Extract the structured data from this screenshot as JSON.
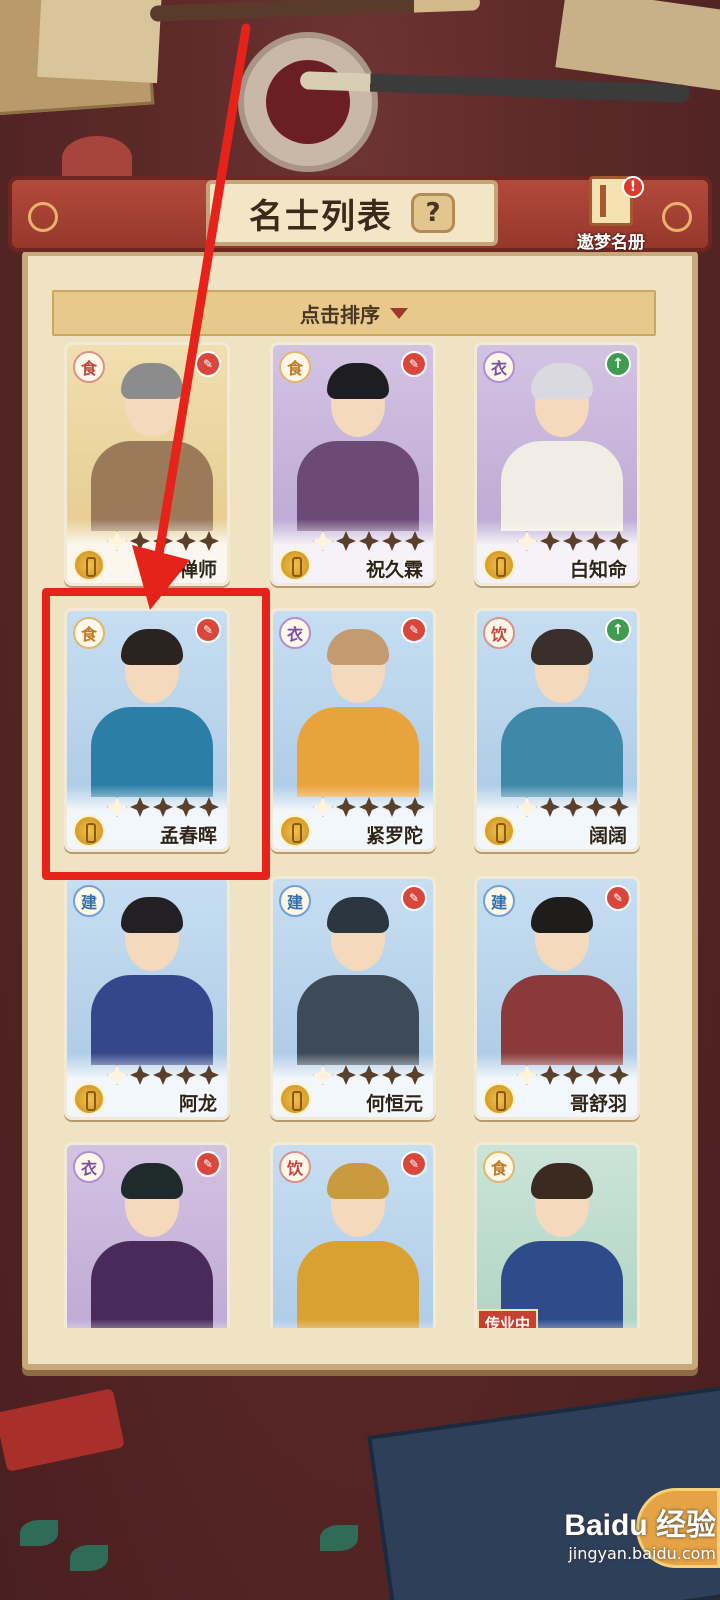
{
  "header": {
    "title": "名士列表",
    "help_symbol": "?",
    "dream_book_label": "遨梦名册",
    "alert_symbol": "!"
  },
  "sort": {
    "label": "点击排序"
  },
  "cards": [
    {
      "name": "禅师",
      "category": "食",
      "theme": "gold",
      "badge": "red",
      "stars_filled": 4,
      "hair": "#8c8c8c",
      "robe": "#9b7a5a",
      "corner": "seal"
    },
    {
      "name": "祝久霖",
      "category": "食",
      "theme": "purple",
      "badge": "gold",
      "stars_filled": 4,
      "hair": "#1e1e22",
      "robe": "#6b4a78",
      "corner": "seal"
    },
    {
      "name": "白知命",
      "category": "衣",
      "theme": "purple",
      "badge": "purple",
      "stars_filled": 4,
      "hair": "#d9d9df",
      "robe": "#f1ece4",
      "corner": "up"
    },
    {
      "name": "孟春晖",
      "category": "食",
      "theme": "blue",
      "badge": "gold",
      "stars_filled": 4,
      "hair": "#2a2320",
      "robe": "#2b7fa6",
      "corner": "seal"
    },
    {
      "name": "紧罗陀",
      "category": "衣",
      "theme": "blue",
      "badge": "purple",
      "stars_filled": 4,
      "hair": "#c49a72",
      "robe": "#e8a33c",
      "corner": "seal"
    },
    {
      "name": "阔阔",
      "category": "饮",
      "theme": "blue",
      "badge": "red",
      "stars_filled": 4,
      "hair": "#3a2f2a",
      "robe": "#3f88a8",
      "corner": "up"
    },
    {
      "name": "阿龙",
      "category": "建",
      "theme": "blue",
      "badge": "blue",
      "stars_filled": 4,
      "hair": "#232025",
      "robe": "#35468a",
      "corner": "none"
    },
    {
      "name": "何恒元",
      "category": "建",
      "theme": "blue",
      "badge": "blue",
      "stars_filled": 4,
      "hair": "#2a3640",
      "robe": "#3d4a58",
      "corner": "seal"
    },
    {
      "name": "哥舒羽",
      "category": "建",
      "theme": "blue",
      "badge": "blue",
      "stars_filled": 4,
      "hair": "#1f1c1c",
      "robe": "#8a3a3a",
      "corner": "seal"
    },
    {
      "name": "",
      "category": "衣",
      "theme": "purple",
      "badge": "purple",
      "stars_filled": 4,
      "hair": "#1f2a2a",
      "robe": "#4a2a5a",
      "corner": "seal"
    },
    {
      "name": "",
      "category": "饮",
      "theme": "blue",
      "badge": "red",
      "stars_filled": 4,
      "hair": "#c99a3e",
      "robe": "#d9a032",
      "corner": "seal"
    },
    {
      "name": "",
      "category": "食",
      "theme": "green",
      "badge": "gold",
      "stars_filled": 4,
      "hair": "#3a2a20",
      "robe": "#2f4c8a",
      "corner": "none",
      "tag": "传业中"
    }
  ],
  "watermark": {
    "logo": "Baidu 经验",
    "sub": "jingyan.baidu.com"
  }
}
